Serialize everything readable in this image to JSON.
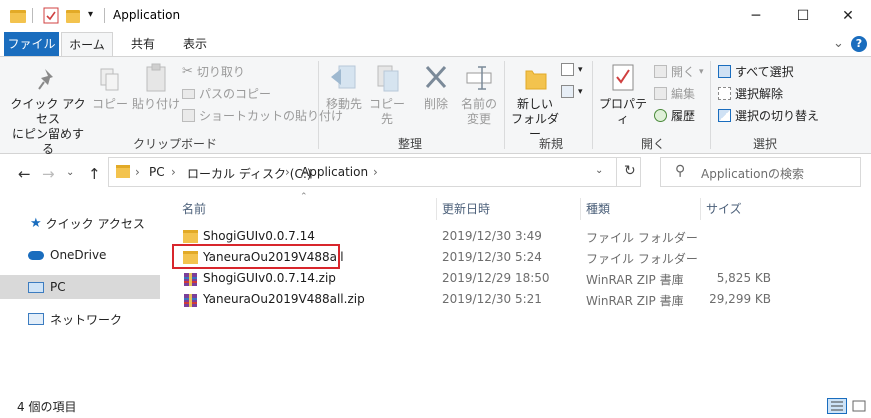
{
  "window": {
    "title": "Application",
    "minimize_glyph": "─",
    "maximize_glyph": "☐",
    "close_glyph": "✕"
  },
  "tabs": [
    "ファイル",
    "ホーム",
    "共有",
    "表示"
  ],
  "help_glyph": "?",
  "collapse_glyph": "⌄",
  "ribbon": {
    "clipboard": {
      "label": "クリップボード",
      "pin_line1": "クイック アクセス",
      "pin_line2": "にピン留めする",
      "copy": "コピー",
      "paste": "貼り付け",
      "cut": "切り取り",
      "copy_path": "パスのコピー",
      "paste_shortcut": "ショートカットの貼り付け"
    },
    "organize": {
      "label": "整理",
      "move_to": "移動先",
      "copy_to": "コピー先",
      "delete": "削除",
      "rename_line1": "名前の",
      "rename_line2": "変更"
    },
    "new": {
      "label": "新規",
      "new_folder_line1": "新しい",
      "new_folder_line2": "フォルダー"
    },
    "open": {
      "label": "開く",
      "properties": "プロパティ",
      "open": "開く",
      "edit": "編集",
      "history": "履歴"
    },
    "select": {
      "label": "選択",
      "select_all": "すべて選択",
      "select_none": "選択解除",
      "invert": "選択の切り替え"
    }
  },
  "address": {
    "crumbs": [
      "PC",
      "ローカル ディスク (C:)",
      "Application"
    ],
    "search_placeholder": "Applicationの検索"
  },
  "nav": {
    "quick_access": "クイック アクセス",
    "onedrive": "OneDrive",
    "pc": "PC",
    "network": "ネットワーク"
  },
  "columns": {
    "name": "名前",
    "date": "更新日時",
    "type": "種類",
    "size": "サイズ"
  },
  "files": [
    {
      "name": "ShogiGUIv0.0.7.14",
      "date": "2019/12/30 3:49",
      "type": "ファイル フォルダー",
      "size": "",
      "kind": "folder"
    },
    {
      "name": "YaneuraOu2019V488all",
      "date": "2019/12/30 5:24",
      "type": "ファイル フォルダー",
      "size": "",
      "kind": "folder"
    },
    {
      "name": "ShogiGUIv0.0.7.14.zip",
      "date": "2019/12/29 18:50",
      "type": "WinRAR ZIP 書庫",
      "size": "5,825 KB",
      "kind": "zip"
    },
    {
      "name": "YaneuraOu2019V488all.zip",
      "date": "2019/12/30 5:21",
      "type": "WinRAR ZIP 書庫",
      "size": "29,299 KB",
      "kind": "zip"
    }
  ],
  "status": {
    "item_count": "4 個の項目"
  },
  "colors": {
    "accent": "#1a6dbe",
    "highlight": "#d8262c",
    "folder": "#f3c34e"
  }
}
